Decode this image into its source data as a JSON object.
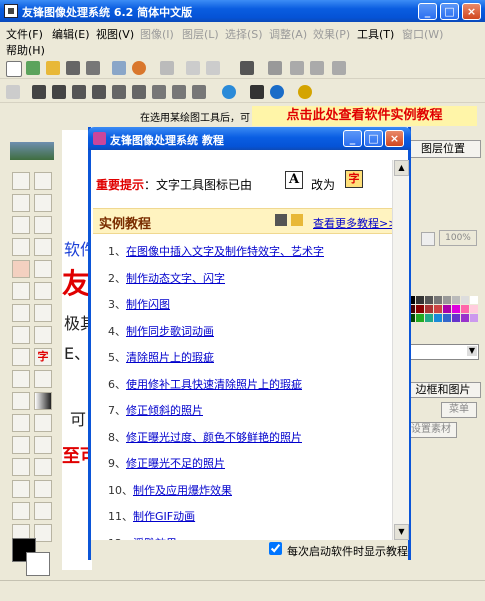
{
  "window": {
    "title": "友锋图像处理系统 6.2 简体中文版"
  },
  "menu": [
    {
      "label": "文件(F)",
      "disabled": false
    },
    {
      "label": "编辑(E)",
      "disabled": false
    },
    {
      "label": "视图(V)",
      "disabled": false
    },
    {
      "label": "图像(I)",
      "disabled": true
    },
    {
      "label": "图层(L)",
      "disabled": true
    },
    {
      "label": "选择(S)",
      "disabled": true
    },
    {
      "label": "调整(A)",
      "disabled": true
    },
    {
      "label": "效果(P)",
      "disabled": true
    },
    {
      "label": "工具(T)",
      "disabled": false
    },
    {
      "label": "窗口(W)",
      "disabled": true
    },
    {
      "label": "帮助(H)",
      "disabled": false
    }
  ],
  "banner": {
    "hint": "在选用某绘图工具后，可",
    "link": "点击此处查看软件实例教程"
  },
  "right_panel": {
    "tab": "图层位置",
    "zoom": "100%",
    "group_label": "边框和图片",
    "menu_button": "菜单",
    "settings_button": "设置素材"
  },
  "canvas_text": [
    "软件",
    "友锋",
    "极其",
    "E、",
    "可",
    "至可"
  ],
  "dialog": {
    "title": "友锋图像处理系统 教程",
    "important_label": "重要提示",
    "important_text": "：文字工具图标已由",
    "important_change": "改为",
    "icon_old": "A",
    "icon_new": "字",
    "section_title": "实例教程",
    "more_link": "查看更多教程>>>",
    "items": [
      {
        "n": "1、",
        "t": "在图像中插入文字及制作特效字、艺术字"
      },
      {
        "n": "2、",
        "t": "制作动态文字、闪字"
      },
      {
        "n": "3、",
        "t": "制作闪图"
      },
      {
        "n": "4、",
        "t": "制作同步歌词动画"
      },
      {
        "n": "5、",
        "t": "清除照片上的瑕疵"
      },
      {
        "n": "6、",
        "t": "使用修补工具快速清除照片上的瑕疵"
      },
      {
        "n": "7、",
        "t": "修正倾斜的照片"
      },
      {
        "n": "8、",
        "t": "修正曝光过度、颜色不够鲜艳的照片"
      },
      {
        "n": "9、",
        "t": "修正曝光不足的照片"
      },
      {
        "n": "10、",
        "t": "制作及应用爆炸效果"
      },
      {
        "n": "11、",
        "t": "制作GIF动画"
      },
      {
        "n": "12、",
        "t": "浮雕效果"
      }
    ],
    "checkbox_label": "每次启动软件时显示教程",
    "checkbox_checked": true
  },
  "colors": {
    "title_blue": "#0553d6",
    "link_blue": "#0000cc",
    "accent_red": "#e00000",
    "panel_bg": "#ece9d8"
  }
}
